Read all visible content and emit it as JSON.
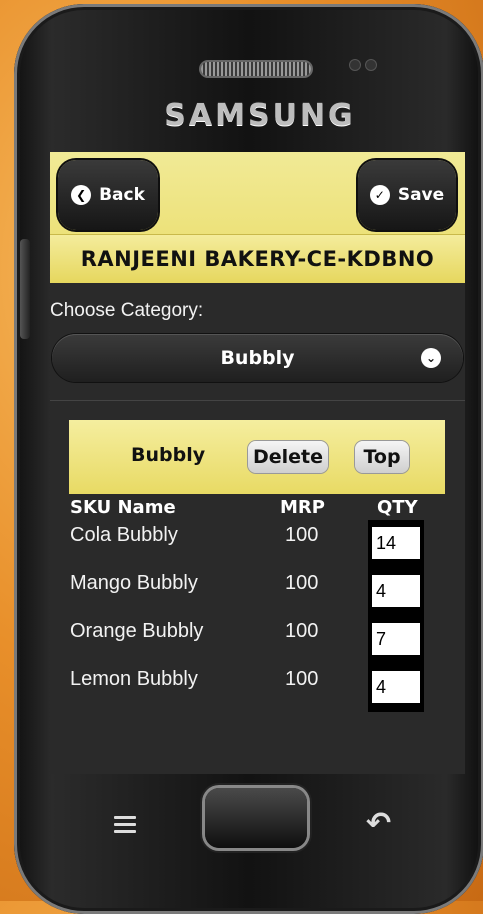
{
  "device": {
    "brand": "SAMSUNG"
  },
  "header": {
    "back_label": "Back",
    "save_label": "Save",
    "title": "RANJEENI BAKERY-CE-KDBNO"
  },
  "category": {
    "label": "Choose Category:",
    "selected": "Bubbly"
  },
  "group_bar": {
    "label": "Bubbly",
    "delete_label": "Delete",
    "top_label": "Top"
  },
  "table": {
    "headers": {
      "sku": "SKU Name",
      "mrp": "MRP",
      "qty": "QTY"
    },
    "rows": [
      {
        "name": "Cola Bubbly",
        "mrp": "100",
        "qty": "14"
      },
      {
        "name": "Mango Bubbly",
        "mrp": "100",
        "qty": "4"
      },
      {
        "name": "Orange Bubbly",
        "mrp": "100",
        "qty": "7"
      },
      {
        "name": "Lemon Bubbly",
        "mrp": "100",
        "qty": "4"
      }
    ]
  },
  "colors": {
    "accent_yellow": "#ece17a",
    "screen_bg": "#2a2a2a",
    "background_orange": "#e88f2a"
  },
  "icons": {
    "back": "chevron-left-icon",
    "save": "checkmark-icon",
    "dropdown": "chevron-down-icon",
    "menu": "menu-icon",
    "nav_back": "return-arrow-icon"
  }
}
